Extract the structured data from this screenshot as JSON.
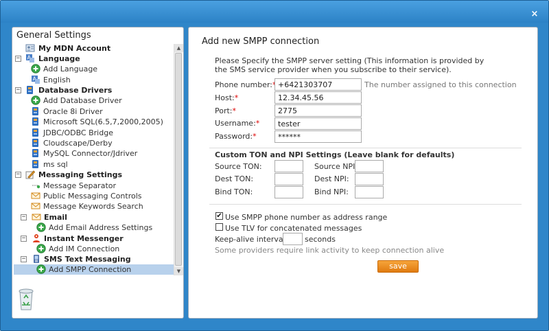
{
  "left": {
    "title": "General Settings",
    "items": [
      {
        "label": "My MDN Account",
        "bold": true,
        "expander": "",
        "icon": "id-card-icon"
      },
      {
        "label": "Language",
        "bold": true,
        "expander": "−",
        "icon": "language-icon"
      },
      {
        "label": "Add Language",
        "bold": false,
        "expander": "",
        "icon": "add-icon"
      },
      {
        "label": "English",
        "bold": false,
        "expander": "",
        "icon": "language-icon"
      },
      {
        "label": "Database Drivers",
        "bold": true,
        "expander": "−",
        "icon": "database-icon"
      },
      {
        "label": "Add Database Driver",
        "bold": false,
        "expander": "",
        "icon": "add-icon"
      },
      {
        "label": "Oracle 8i Driver",
        "bold": false,
        "expander": "",
        "icon": "database-icon"
      },
      {
        "label": "Microsoft SQL(6.5,7,2000,2005)",
        "bold": false,
        "expander": "",
        "icon": "database-icon"
      },
      {
        "label": "JDBC/ODBC Bridge",
        "bold": false,
        "expander": "",
        "icon": "database-icon"
      },
      {
        "label": "Cloudscape/Derby",
        "bold": false,
        "expander": "",
        "icon": "database-icon"
      },
      {
        "label": "MySQL Connector/Jdriver",
        "bold": false,
        "expander": "",
        "icon": "database-icon"
      },
      {
        "label": "ms sql",
        "bold": false,
        "expander": "",
        "icon": "database-icon"
      },
      {
        "label": "Messaging Settings",
        "bold": true,
        "expander": "−",
        "icon": "pencil-icon"
      },
      {
        "label": "Message Separator",
        "bold": false,
        "expander": "",
        "icon": "separator-icon"
      },
      {
        "label": "Public Messaging Controls",
        "bold": false,
        "expander": "",
        "icon": "envelope-icon"
      },
      {
        "label": "Message Keywords Search",
        "bold": false,
        "expander": "",
        "icon": "envelope-icon"
      },
      {
        "label": "Email",
        "bold": true,
        "expander": "−",
        "icon": "envelope-icon"
      },
      {
        "label": "Add Email Address Settings",
        "bold": false,
        "expander": "",
        "icon": "add-icon"
      },
      {
        "label": "Instant Messenger",
        "bold": true,
        "expander": "−",
        "icon": "messenger-icon"
      },
      {
        "label": "Add IM Connection",
        "bold": false,
        "expander": "",
        "icon": "add-icon"
      },
      {
        "label": "SMS Text Messaging",
        "bold": true,
        "expander": "−",
        "icon": "sms-icon"
      },
      {
        "label": "Add SMPP Connection",
        "bold": false,
        "expander": "",
        "icon": "add-icon",
        "selected": true
      }
    ]
  },
  "form": {
    "title": "Add new SMPP connection",
    "description": "Please Specify the SMPP server setting (This information is provided by the SMS service provider when you subscribe to their service).",
    "phone_label": "Phone number:",
    "phone_value": "+6421303707",
    "phone_hint": "The number assigned to this connection",
    "host_label": "Host:",
    "host_value": "12.34.45.56",
    "port_label": "Port:",
    "port_value": "2775",
    "username_label": "Username:",
    "username_value": "tester",
    "password_label": "Password:",
    "password_value": "******",
    "required_mark": "*",
    "ton_section_title": "Custom TON and NPI Settings (Leave blank for defaults)",
    "source_ton_label": "Source TON:",
    "source_npi_label": "Source NPI:",
    "dest_ton_label": "Dest TON:",
    "dest_npi_label": "Dest NPI:",
    "bind_ton_label": "Bind TON:",
    "bind_npi_label": "Bind NPI:",
    "use_range_label": "Use SMPP phone number as address range",
    "use_range_checked": true,
    "use_tlv_label": "Use TLV for concatenated messages",
    "use_tlv_checked": false,
    "keepalive_label": "Keep-alive interval:",
    "keepalive_unit": "seconds",
    "keepalive_note": "Some providers require link activity to keep connection alive",
    "save_label": "save"
  },
  "colors": {
    "frame": "#2f86c9",
    "save_button": "#e88a1f",
    "selected_row": "#b8d1ec"
  }
}
